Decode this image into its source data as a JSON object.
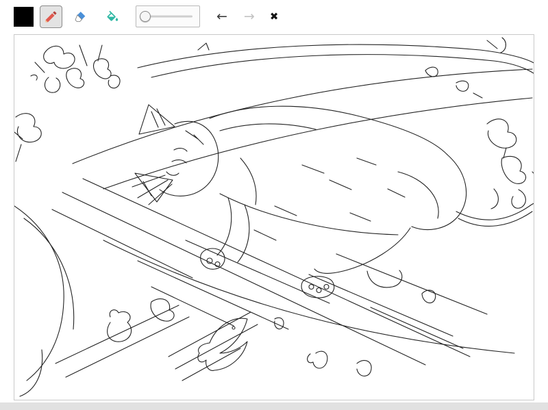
{
  "toolbar": {
    "color_swatch": {
      "color": "#000000",
      "style": "background:#000000"
    },
    "tools": {
      "pencil": {
        "name": "Pencil",
        "selected": true
      },
      "eraser": {
        "name": "Eraser",
        "selected": false
      },
      "fill": {
        "name": "Fill",
        "selected": false
      }
    },
    "brush_slider": {
      "label": "Brush size",
      "thumb_style": "left:14%"
    },
    "undo": {
      "glyph": "←",
      "enabled": true,
      "label": "Undo"
    },
    "redo": {
      "glyph": "→",
      "enabled": false,
      "label": "Redo"
    },
    "clear": {
      "glyph": "✖",
      "label": "Clear canvas"
    }
  },
  "canvas": {
    "description": "Black-and-white line sketch of a cat sleeping on a wooden bench, surrounded by scattered leaves"
  },
  "colors": {
    "swatch": "#000000",
    "pencil_body": "#e0594f",
    "pencil_cap": "#b5443c",
    "pencil_tip": "#f2c28f",
    "eraser_top": "#4a90d9",
    "eraser_bottom": "#ffffff",
    "fill_bucket": "#2fb8a4",
    "selected_tool_bg": "#e3e3e3",
    "selected_tool_border": "#8a8a8a",
    "sketch_stroke": "#222222"
  }
}
